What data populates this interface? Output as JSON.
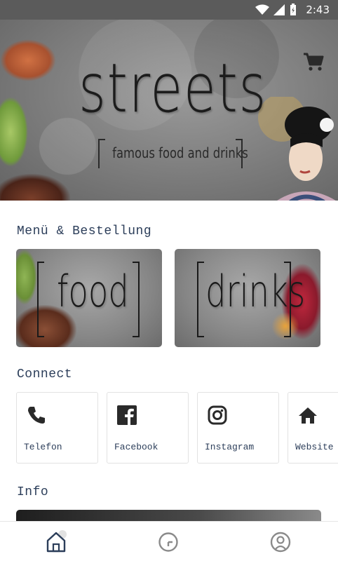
{
  "status_bar": {
    "time": "2:43"
  },
  "hero": {
    "title": "streets",
    "subtitle": "famous food and drinks"
  },
  "sections": {
    "menu_title": "Menü & Bestellung",
    "connect_title": "Connect",
    "info_title": "Info"
  },
  "menu_cards": [
    {
      "label": "food"
    },
    {
      "label": "drinks"
    }
  ],
  "connect_tiles": [
    {
      "label": "Telefon",
      "icon": "phone-icon"
    },
    {
      "label": "Facebook",
      "icon": "facebook-icon"
    },
    {
      "label": "Instagram",
      "icon": "instagram-icon"
    },
    {
      "label": "Website",
      "icon": "home-icon"
    }
  ],
  "bottom_nav": [
    {
      "icon": "home-icon",
      "active": true
    },
    {
      "icon": "clock-icon"
    },
    {
      "icon": "user-icon"
    }
  ],
  "colors": {
    "accent_text": "#2c3e5a",
    "status_bar": "#5b5b5b",
    "icon_dark": "#2a2a2a"
  }
}
